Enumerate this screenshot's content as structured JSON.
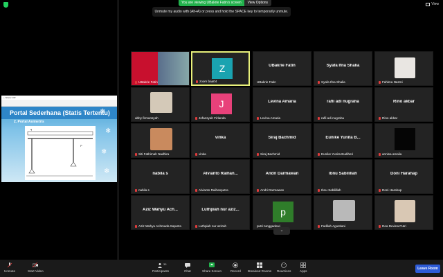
{
  "header": {
    "viewing_text": "You are viewing UBakrie Fatin's screen",
    "view_options": "View Options",
    "view_label": "View",
    "unmute_tip": "Unmute my audio with (Alt+A) or press and hold the SPACE key to temporarily unmute."
  },
  "share": {
    "window_title": "+ Sharer 10#",
    "slide_title": "Portal Sederhana (Statis Tertentu)",
    "slide_sub": "2. Portal Asimetris"
  },
  "tiles": [
    {
      "big": "",
      "label": "UBakrie Fatin"
    },
    {
      "big": "Z",
      "label": "zoom baa04"
    },
    {
      "big": "UBakrie Fatin",
      "label": "UBakrie Fatin"
    },
    {
      "big": "Syafa Ifna Shalia",
      "label": "Syafa Ifna Shalia"
    },
    {
      "big": "",
      "label": "Fahima Nazmi"
    },
    {
      "big": "",
      "label": "abby firmansyah"
    },
    {
      "big": "J",
      "label": "Jofansyah Firlanda"
    },
    {
      "big": "Levina Amaria",
      "label": "Levina Amaria"
    },
    {
      "big": "rafli adi nugraha",
      "label": "rafli adi nugraha"
    },
    {
      "big": "Rino akbar",
      "label": "Rino akbar"
    },
    {
      "big": "",
      "label": "Siti Fathimah Nadhira"
    },
    {
      "big": "vinka",
      "label": "vinka"
    },
    {
      "big": "Siraj Bachmid",
      "label": "Siraj Bachmid"
    },
    {
      "big": "Eunike Yunita B...",
      "label": "Eunike Yunita Budiheri"
    },
    {
      "big": "",
      "label": "annisa amalia"
    },
    {
      "big": "nabila s",
      "label": "nabila s"
    },
    {
      "big": "Alvianto Raihan...",
      "label": "Alvianto Raihanputra"
    },
    {
      "big": "Andri Darmawan",
      "label": "Andri Darmawan"
    },
    {
      "big": "Ibnu Sabilillah",
      "label": "Ibnu Sabilillah"
    },
    {
      "big": "Doni Harahap",
      "label": "Doni Harahap"
    },
    {
      "big": "Aziz Wahyu Ach...",
      "label": "Aziz Wahyu Achmada Saputra"
    },
    {
      "big": "Luthpiah nur aziz...",
      "label": "Luthpiah nur azizah"
    },
    {
      "big": "p",
      "label": "putri tunggadewi"
    },
    {
      "big": "",
      "label": "Fadilah Agustiani"
    },
    {
      "big": "",
      "label": "Dea Devina Putri"
    }
  ],
  "colors": {
    "z_avatar": "#1aa3b0",
    "j_avatar": "#e8417a",
    "p_avatar": "#2f7d2a",
    "leave": "#2d5bd6",
    "active_border": "#e8f07a"
  },
  "toolbar": {
    "unmute": "Unmute",
    "start_video": "Start Video",
    "participants": "Participants",
    "participants_count": "35",
    "chat": "Chat",
    "share_screen": "Share Screen",
    "record": "Record",
    "breakout": "Breakout Rooms",
    "reactions": "Reactions",
    "apps": "Apps",
    "leave": "Leave Room"
  }
}
